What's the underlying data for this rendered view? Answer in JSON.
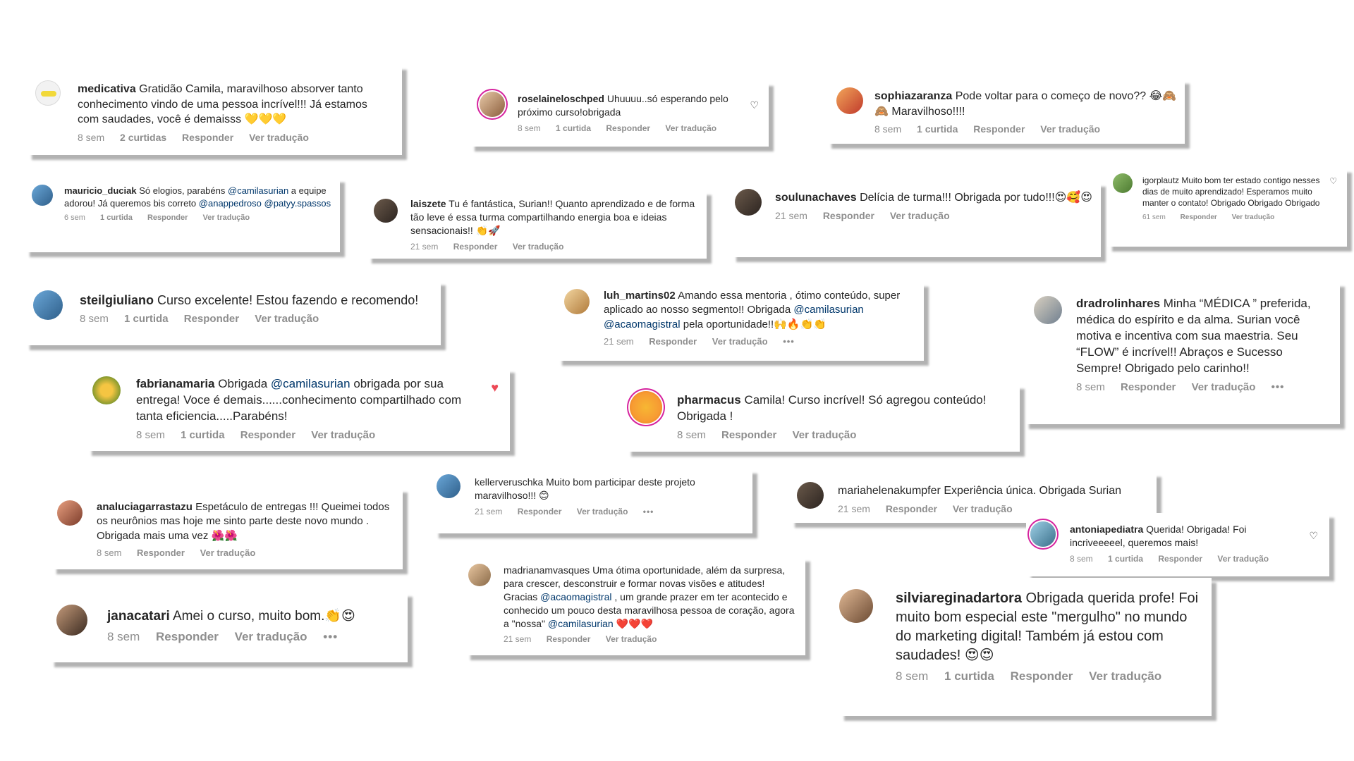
{
  "labels": {
    "reply": "Responder",
    "translate": "Ver tradução",
    "more": "•••"
  },
  "comments": [
    {
      "user": "medicativa",
      "text": "Gratidão Camila, maravilhoso absorver tanto conhecimento vindo de uma pessoa incrível!!! Já estamos com saudades, você é demaisss 💛💛💛",
      "time": "8 sem",
      "likes": "2 curtidas"
    },
    {
      "user": "roselaineloschped",
      "text": "Uhuuuu..só esperando pelo próximo curso!obrigada",
      "time": "8 sem",
      "likes": "1 curtida"
    },
    {
      "user": "sophiazaranza",
      "text": "Pode voltar para o começo de novo?? 😂🙈🙈 Maravilhoso!!!!",
      "time": "8 sem",
      "likes": "1 curtida"
    },
    {
      "user": "mauricio_duciak",
      "text_a": "Só elogios, parabéns ",
      "mention_a": "@camilasurian",
      "text_b": " a equipe adorou! Já queremos bis correto ",
      "mention_b": "@anappedroso",
      "mention_c": "@patyy.spassos",
      "time": "6 sem",
      "likes": "1 curtida"
    },
    {
      "user": "laiszete",
      "text": "Tu é fantástica, Surian!! Quanto aprendizado e de forma tão leve é essa turma compartilhando energia boa e ideias sensacionais!! 👏🚀",
      "time": "21 sem"
    },
    {
      "user": "soulunachaves",
      "text": "Delícia de turma!!! Obrigada por tudo!!!😍🥰😍",
      "time": "21 sem"
    },
    {
      "user": "igorplautz",
      "text": "Muito bom ter estado contigo nesses dias de muito aprendizado! Esperamos muito manter o contato! Obrigado Obrigado Obrigado",
      "time": "61 sem"
    },
    {
      "user": "steilgiuliano",
      "text": "Curso excelente! Estou fazendo e recomendo!",
      "time": "8 sem",
      "likes": "1 curtida"
    },
    {
      "user": "luh_martins02",
      "text_a": "Amando essa mentoria , ótimo conteúdo, super aplicado ao nosso segmento!! Obrigada ",
      "mention_a": "@camilasurian",
      "mention_b": "@acaomagistral",
      "text_b": " pela oportunidade!!🙌🔥👏👏",
      "time": "21 sem"
    },
    {
      "user": "dradrolinhares",
      "text": "Minha “MÉDICA ” preferida, médica do espírito e da alma. Surian você motiva e incentiva com sua maestria. Seu “FLOW” é incrível!! Abraços e Sucesso Sempre! Obrigado pelo carinho!!",
      "time": "8 sem"
    },
    {
      "user": "fabrianamaria",
      "text_a": "Obrigada ",
      "mention_a": "@camilasurian",
      "text_b": " obrigada por sua entrega! Voce é demais......conhecimento compartilhado com tanta eficiencia.....Parabéns!",
      "time": "8 sem",
      "likes": "1 curtida"
    },
    {
      "user": "pharmacus",
      "text": "Camila! Curso incrível! Só agregou conteúdo! Obrigada !",
      "time": "8 sem"
    },
    {
      "user": "kellerveruschka",
      "text": "Muito bom participar deste projeto maravilhoso!!! 😊",
      "time": "21 sem"
    },
    {
      "user": "mariahelenakumpfer",
      "text": "Experiência única. Obrigada Surian",
      "time": "21 sem"
    },
    {
      "user": "analuciagarrastazu",
      "text": "Espetáculo de entregas !!! Queimei todos os neurônios mas hoje me sinto parte deste novo mundo . Obrigada mais uma vez 🌺🌺",
      "time": "8 sem"
    },
    {
      "user": "antoniapediatra",
      "text": "Querida! Obrigada! Foi incriveeeeel, queremos mais!",
      "time": "8 sem",
      "likes": "1 curtida"
    },
    {
      "user": "madrianamvasques",
      "text_a": "Uma ótima oportunidade, além da surpresa, para crescer, desconstruir e formar novas visões e atitudes! Gracias ",
      "mention_a": "@acaomagistral",
      "text_b": " , um grande prazer em ter acontecido e conhecido um pouco desta maravilhosa pessoa de coração, agora a \"nossa\" ",
      "mention_b": "@camilasurian",
      "text_c": " ❤️❤️❤️",
      "time": "21 sem"
    },
    {
      "user": "janacatari",
      "text": "Amei o curso, muito bom.👏😍",
      "time": "8 sem"
    },
    {
      "user": "silviareginadartora",
      "text": "Obrigada querida profe! Foi muito bom especial este \"mergulho\" no mundo do marketing digital! Também já estou com saudades! 😍😍",
      "time": "8 sem",
      "likes": "1 curtida"
    }
  ]
}
